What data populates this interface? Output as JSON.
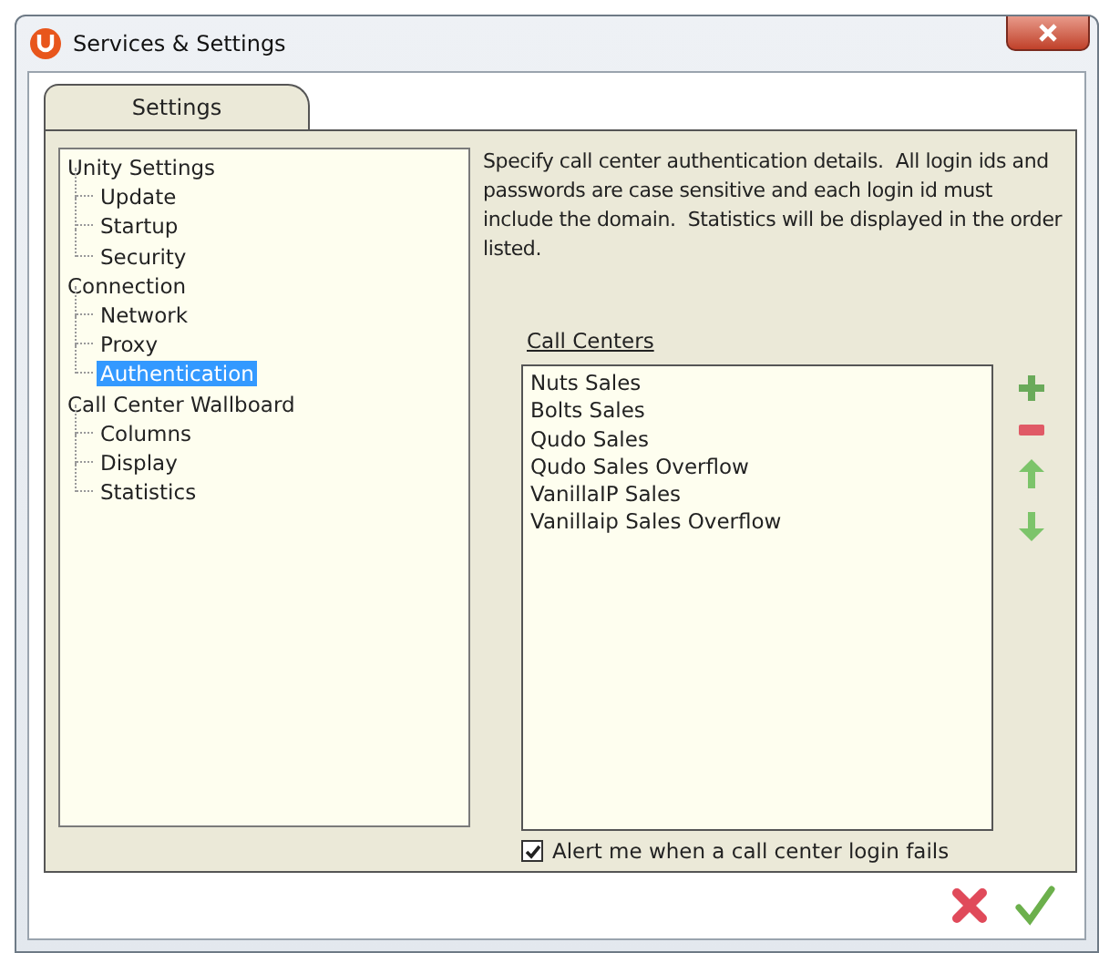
{
  "window": {
    "title": "Services & Settings"
  },
  "tabs": [
    {
      "label": "Settings",
      "selected": true
    }
  ],
  "tree": [
    {
      "label": "Unity Settings",
      "selected": false,
      "children": [
        {
          "label": "Update",
          "selected": false
        },
        {
          "label": "Startup",
          "selected": false
        },
        {
          "label": "Security",
          "selected": false
        }
      ]
    },
    {
      "label": "Connection",
      "selected": false,
      "children": [
        {
          "label": "Network",
          "selected": false
        },
        {
          "label": "Proxy",
          "selected": false
        },
        {
          "label": "Authentication",
          "selected": true
        }
      ]
    },
    {
      "label": "Call Center Wallboard",
      "selected": false,
      "children": [
        {
          "label": "Columns",
          "selected": false
        },
        {
          "label": "Display",
          "selected": false
        },
        {
          "label": "Statistics",
          "selected": false
        }
      ]
    }
  ],
  "description": "Specify call center authentication details.  All login ids and passwords are case sensitive and each login id must include the domain.  Statistics will be displayed in the order listed.",
  "call_centers": {
    "label": "Call Centers",
    "items": [
      "Nuts Sales",
      "Bolts Sales",
      "Qudo Sales",
      "Qudo Sales Overflow",
      "VanillaIP Sales",
      "Vanillaip Sales Overflow"
    ]
  },
  "alert_checkbox": {
    "label": "Alert me when a call center login fails",
    "checked": true
  }
}
